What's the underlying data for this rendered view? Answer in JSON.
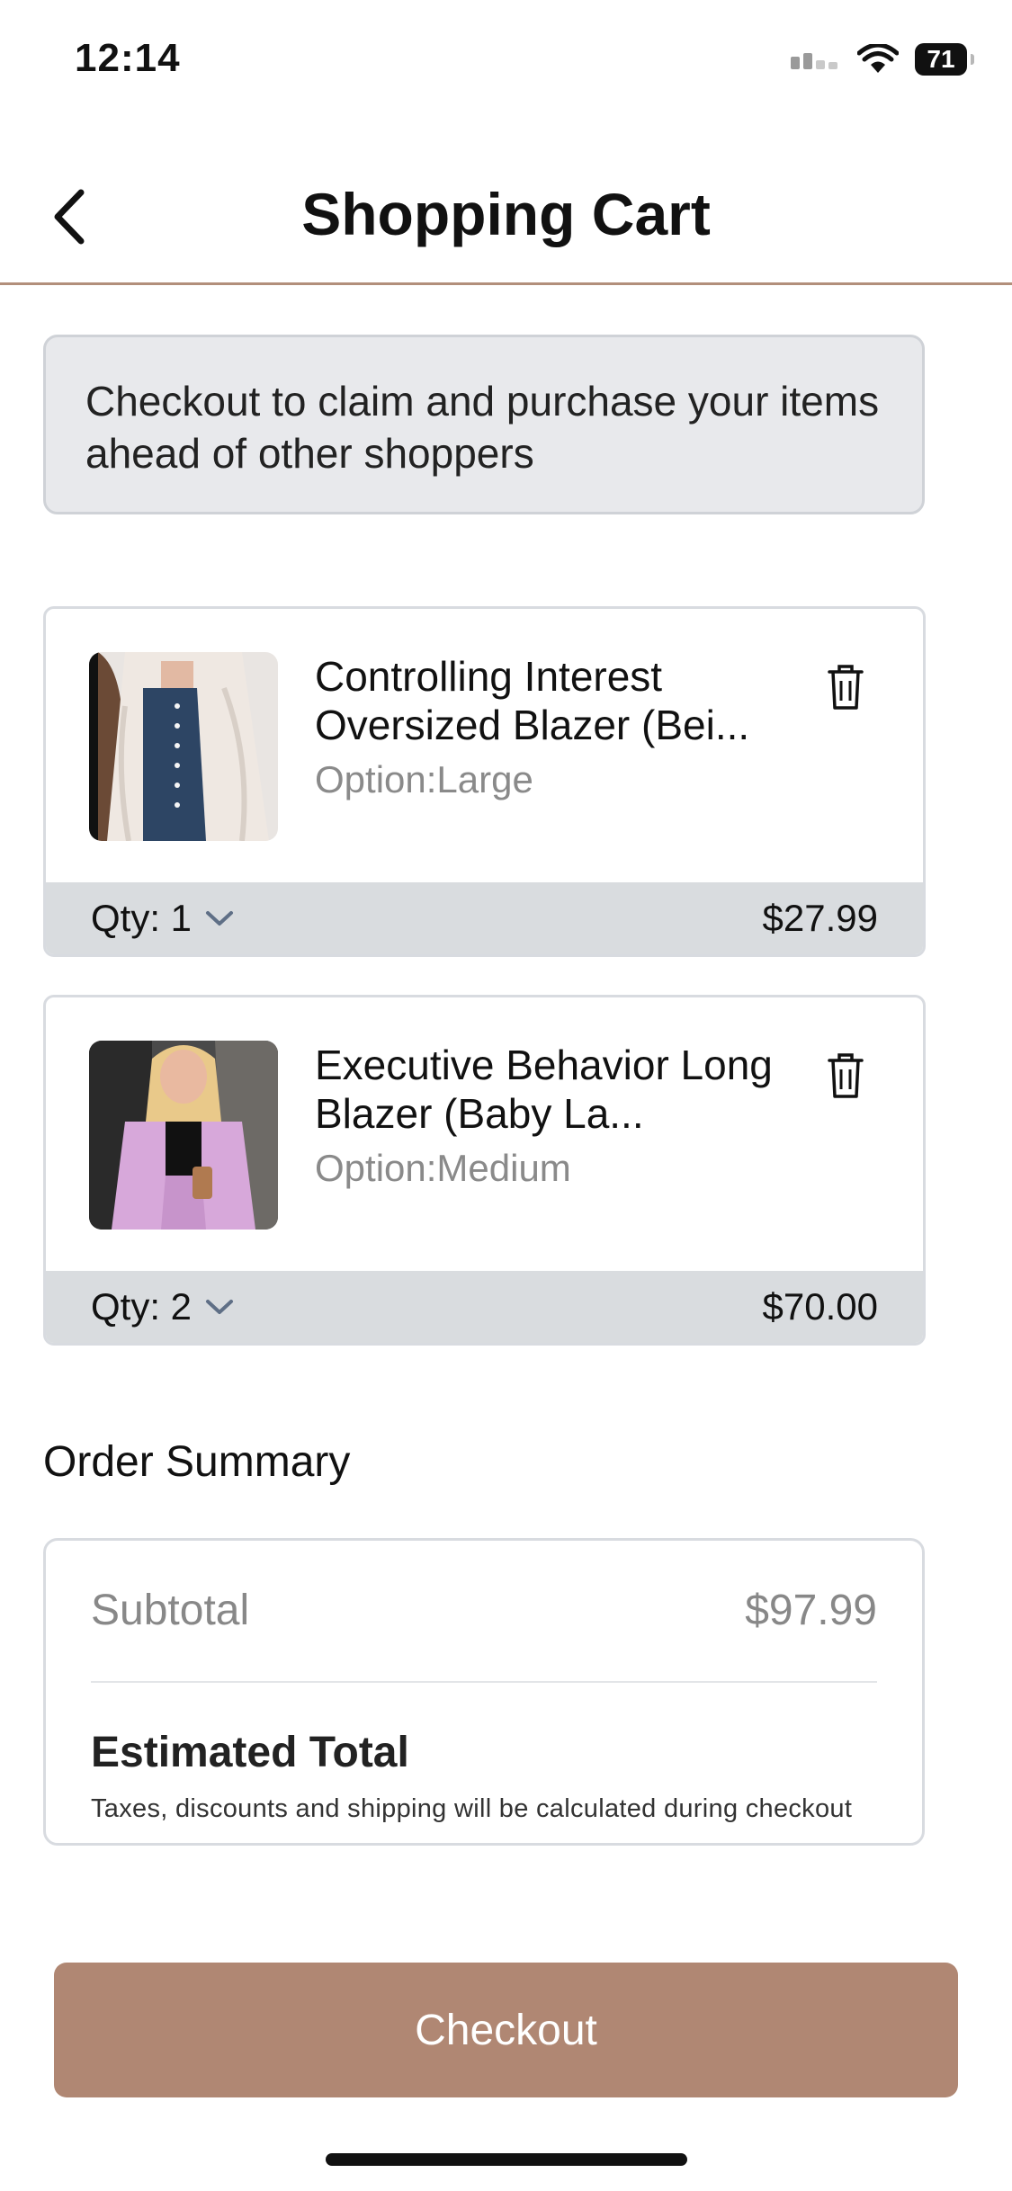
{
  "status_bar": {
    "time": "12:14",
    "battery": "71"
  },
  "header": {
    "title": "Shopping Cart"
  },
  "notice": {
    "text": "Checkout to claim and purchase your items ahead of other shoppers"
  },
  "cart": {
    "items": [
      {
        "name": "Controlling Interest Oversized Blazer (Bei...",
        "option": "Option:Large",
        "qty": "Qty: 1",
        "price": "$27.99"
      },
      {
        "name": "Executive Behavior Long Blazer (Baby La...",
        "option": "Option:Medium",
        "qty": "Qty: 2",
        "price": "$70.00"
      }
    ]
  },
  "summary": {
    "heading": "Order Summary",
    "subtotal_label": "Subtotal",
    "subtotal_value": "$97.99",
    "estimated_total_label": "Estimated Total",
    "note": "Taxes, discounts and shipping will be calculated during checkout"
  },
  "checkout": {
    "label": "Checkout"
  },
  "colors": {
    "accent": "#b08773",
    "header_divider": "#b28f7b",
    "notice_bg": "#e8e9ec",
    "qty_bar_bg": "#d9dcdf"
  },
  "icons": [
    "back-chevron-icon",
    "trash-icon",
    "chevron-down-icon",
    "wifi-icon",
    "signal-icon",
    "battery-icon"
  ]
}
